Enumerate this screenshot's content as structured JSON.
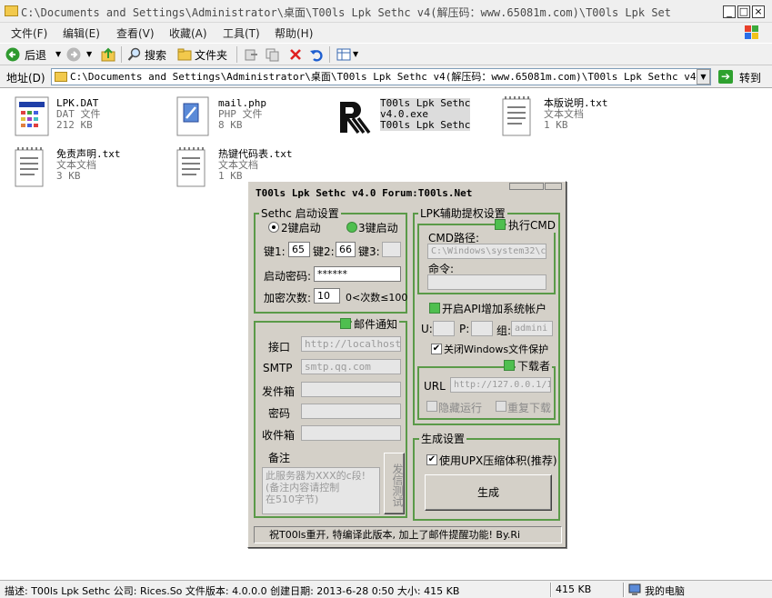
{
  "window": {
    "title": "C:\\Documents and Settings\\Administrator\\桌面\\T00ls Lpk Sethc v4(解压码：www.65081m.com)\\T00ls Lpk Set",
    "controls": [
      "_",
      "□",
      "×"
    ]
  },
  "menubar": [
    "文件(F)",
    "编辑(E)",
    "查看(V)",
    "收藏(A)",
    "工具(T)",
    "帮助(H)"
  ],
  "toolbar": {
    "back": "后退",
    "search": "搜索",
    "folders": "文件夹"
  },
  "address": {
    "label": "地址(D)",
    "path": "C:\\Documents and Settings\\Administrator\\桌面\\T00ls Lpk Sethc v4(解压码：www.65081m.com)\\T00ls Lpk Sethc v4",
    "go": "转到"
  },
  "files": [
    {
      "name": "LPK.DAT",
      "type": "DAT 文件",
      "size": "212 KB",
      "icon": "dat-file-icon"
    },
    {
      "name": "mail.php",
      "type": "PHP 文件",
      "size": "8 KB",
      "icon": "php-file-icon"
    },
    {
      "name": "T00ls Lpk Sethc",
      "type": "v4.0.exe",
      "size": "T00ls Lpk Sethc",
      "icon": "app-logo-icon"
    },
    {
      "name": "本版说明.txt",
      "type": "文本文档",
      "size": "1 KB",
      "icon": "text-file-icon"
    },
    {
      "name": "免责声明.txt",
      "type": "文本文档",
      "size": "3 KB",
      "icon": "text-file-icon"
    },
    {
      "name": "热键代码表.txt",
      "type": "文本文档",
      "size": "1 KB",
      "icon": "text-file-icon"
    }
  ],
  "app": {
    "title": "T00ls Lpk Sethc v4.0   Forum:T00ls.Net",
    "sethc": {
      "group": "Sethc 启动设置",
      "radio2": "2键启动",
      "radio3": "3键启动",
      "key1_label": "键1:",
      "key1": "65",
      "key2_label": "键2:",
      "key2": "66",
      "key3_label": "键3:",
      "key3": "",
      "pwd_label": "启动密码:",
      "pwd": "******",
      "enc_label": "加密次数:",
      "enc": "10",
      "enc_hint": "0<次数≤100"
    },
    "mail": {
      "group": "邮件通知",
      "port_label": "接口",
      "port": "http://localhost/",
      "smtp_label": "SMTP",
      "smtp": "smtp.qq.com",
      "sender_label": "发件箱",
      "sender": "",
      "pass_label": "密码",
      "pass": "",
      "recv_label": "收件箱",
      "recv": "",
      "note_label": "备注",
      "note": "此服务器为XXX的c段!\n(备注内容请控制\n在510字节)",
      "test_btn": "发信测试"
    },
    "lpk": {
      "group": "LPK辅助提权设置",
      "exec_cmd": "执行CMD",
      "cmd_path_label": "CMD路径:",
      "cmd_path": "C:\\Windows\\system32\\c",
      "cmd_label": "命令:",
      "cmd": "",
      "api_label": "开启API增加系统帐户",
      "u_label": "U:",
      "u": "",
      "p_label": "P:",
      "p": "",
      "group_label": "组:",
      "group_val": "admini",
      "wfp_label": "关闭Windows文件保护"
    },
    "downloader": {
      "group": "下载者",
      "url_label": "URL",
      "url": "http://127.0.0.1/1",
      "hidden_label": "隐藏运行",
      "redownload_label": "重复下载"
    },
    "build": {
      "group": "生成设置",
      "upx_label": "使用UPX压缩体积(推荐)",
      "build_btn": "生成"
    },
    "marquee": "祝T00ls重开, 特编译此版本, 加上了邮件提醒功能!  By.Ri"
  },
  "statusbar": {
    "desc": "描述: T00ls Lpk Sethc 公司: Rices.So 文件版本: 4.0.0.0 创建日期: 2013-6-28 0:50 大小: 415 KB",
    "size": "415 KB",
    "location": "我的电脑"
  }
}
